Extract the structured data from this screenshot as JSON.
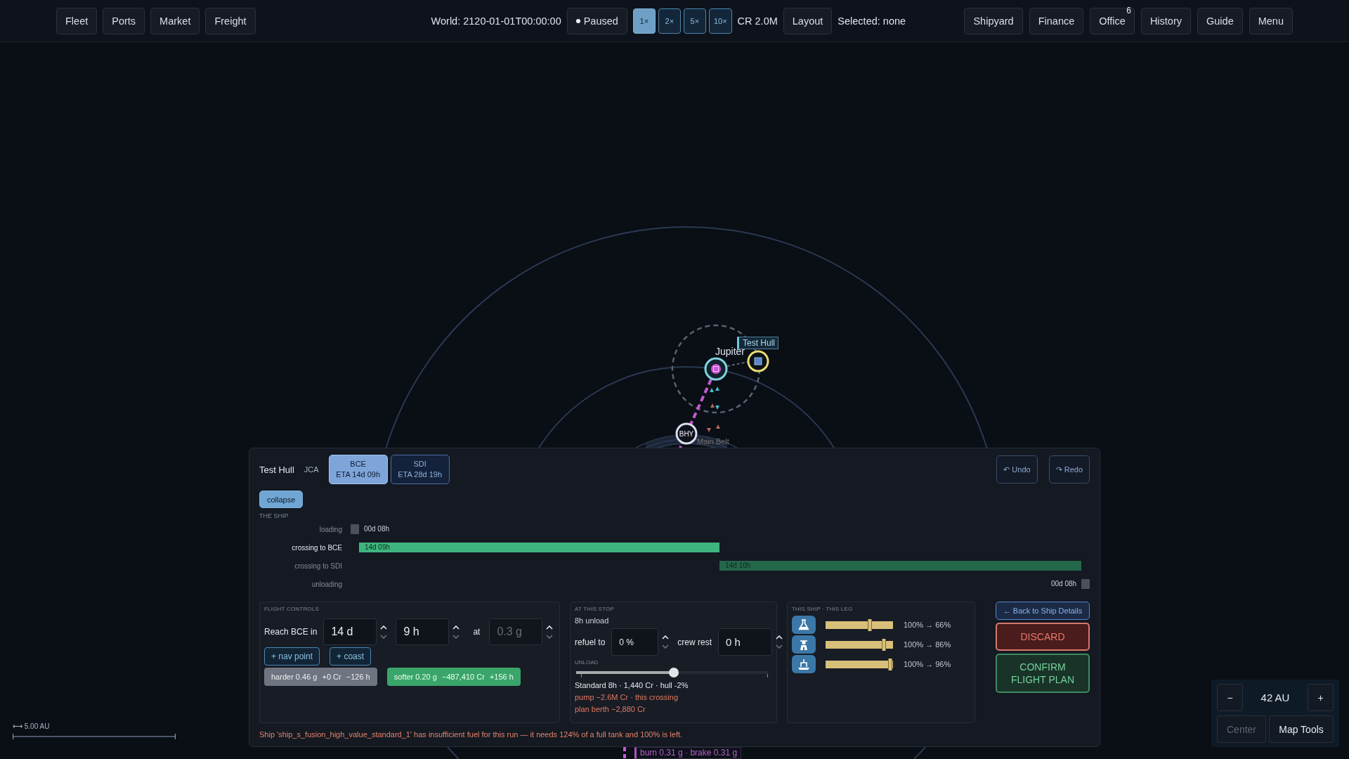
{
  "top_bar": {
    "left_buttons": [
      {
        "label": "Fleet"
      },
      {
        "label": "Ports"
      },
      {
        "label": "Market"
      },
      {
        "label": "Freight"
      }
    ],
    "world_time": "World: 2120-01-01T00:00:00",
    "pause_button": {
      "label": "Paused"
    },
    "speed_buttons": [
      {
        "label": "1×",
        "selected": true
      },
      {
        "label": "2×",
        "selected": false
      },
      {
        "label": "5×",
        "selected": false
      },
      {
        "label": "10×",
        "selected": false
      }
    ],
    "credits": "CR 2.0M",
    "layout_button": {
      "label": "Layout"
    },
    "selection": "Selected: none",
    "right_buttons": [
      {
        "label": "Shipyard"
      },
      {
        "label": "Finance"
      },
      {
        "label": "Office",
        "badge": "6"
      },
      {
        "label": "History"
      },
      {
        "label": "Guide"
      },
      {
        "label": "Menu"
      }
    ]
  },
  "map": {
    "planet": {
      "label": "Jupiter"
    },
    "ship": {
      "label": "Test Hull"
    },
    "station": {
      "label": "BHY"
    },
    "belt": {
      "label": "Main Belt"
    },
    "route_label": "burn 0.31 g · brake 0.31 g",
    "scale": {
      "label": "⟷ 5.00 AU"
    }
  },
  "flight_plan": {
    "ship_name": "Test Hull",
    "ship_code": "JCA",
    "destination_tabs": [
      {
        "label": "BCE",
        "eta": "ETA 14d 09h",
        "selected": true
      },
      {
        "label": "SDI",
        "eta": "ETA 28d 19h",
        "selected": false
      }
    ],
    "undo_button": {
      "label": "↶ Undo"
    },
    "redo_button": {
      "label": "↷ Redo"
    },
    "collapse_button": {
      "label": "collapse"
    },
    "section_label": "THE SHIP",
    "timeline": [
      {
        "kind": "stop",
        "label": "loading",
        "duration": "00d 08h",
        "selected": false
      },
      {
        "kind": "leg",
        "label": "crossing to BCE",
        "duration": "14d 09h",
        "selected": true
      },
      {
        "kind": "leg",
        "label": "crossing to SDI",
        "duration": "14d 10h",
        "selected": false
      },
      {
        "kind": "stop",
        "label": "unloading",
        "duration": "00d 08h",
        "selected": false
      }
    ],
    "flight_controls": {
      "title": "FLIGHT CONTROLS",
      "reach_label": "Reach BCE in",
      "days": {
        "value": "14 d",
        "disabled": false
      },
      "hours": {
        "value": "9 h",
        "disabled": false
      },
      "at_label": "at",
      "accel": {
        "value": "0.3 g",
        "disabled": true
      },
      "add_buttons": [
        {
          "label": "+ nav point"
        },
        {
          "label": "+ coast"
        }
      ],
      "alternatives": [
        {
          "kind": "harder",
          "parts": [
            "harder 0.46 g",
            "+0 Cr",
            "−126 h"
          ]
        },
        {
          "kind": "softer",
          "parts": [
            "softer 0.20 g",
            "−487,410 Cr",
            "+156 h"
          ]
        }
      ]
    },
    "stop": {
      "title": "AT THIS STOP",
      "unload_time": "8h unload",
      "refuel_label": "refuel to",
      "refuel": {
        "value": "0 %"
      },
      "crew_label": "crew rest",
      "crew_rest": {
        "value": "0 h"
      },
      "unload_label": "UNLOAD",
      "unload_slider": {
        "level": 0.51
      },
      "notes": [
        {
          "kind": "info",
          "text": "Standard 8h · 1,440 Cr · hull -2%"
        },
        {
          "kind": "cost",
          "text": "pump −2.6M Cr · this crossing"
        },
        {
          "kind": "cost",
          "text": "plan berth −2,880 Cr"
        }
      ]
    },
    "ship_leg": {
      "title": "THIS SHIP · THIS LEG",
      "gauges": [
        {
          "kind": "fuel",
          "now": {
            "level": 1
          },
          "after": {
            "level": 0.66
          },
          "reading": "100% → 66%"
        },
        {
          "kind": "crew",
          "now": {
            "level": 1
          },
          "after": {
            "level": 0.86
          },
          "reading": "100% → 86%"
        },
        {
          "kind": "hull",
          "now": {
            "level": 1
          },
          "after": {
            "level": 0.96
          },
          "reading": "100% → 96%"
        }
      ]
    },
    "actions": [
      {
        "kind": "back",
        "label": "← Back to Ship Details"
      },
      {
        "kind": "discard",
        "label": "DISCARD"
      },
      {
        "kind": "confirm",
        "label": "CONFIRM FLIGHT PLAN"
      }
    ],
    "warning": "Ship 'ship_s_fusion_high_value_standard_1' has insufficient fuel for this run — it needs 124% of a full tank and 100% is left."
  },
  "zoom_control": {
    "zoom_out": {
      "label": "−"
    },
    "range": "42 AU",
    "zoom_in": {
      "label": "+"
    },
    "buttons": [
      {
        "label": "Center",
        "disabled": true
      },
      {
        "label": "Map Tools",
        "disabled": false
      }
    ]
  }
}
